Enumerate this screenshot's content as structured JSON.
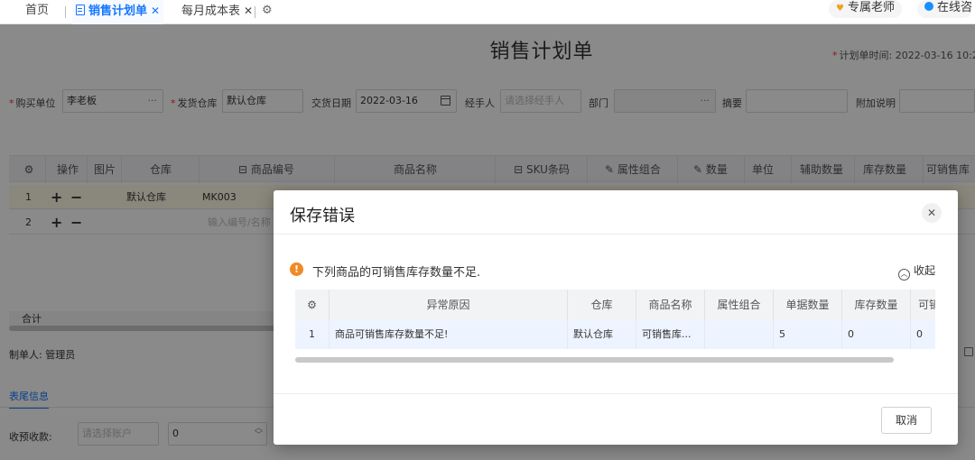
{
  "tabs": {
    "home": "首页",
    "sales_plan": "销售计划单",
    "monthly_cost": "每月成本表",
    "close_glyph": "✕"
  },
  "top_right": {
    "teacher": "专属老师",
    "online": "在线咨"
  },
  "page": {
    "title": "销售计划单",
    "plan_time_label": "计划单时间:",
    "plan_time_value": "2022-03-16 10:2"
  },
  "form": {
    "buyer_label": "购买单位",
    "buyer_value": "李老板",
    "warehouse_label": "发货仓库",
    "warehouse_value": "默认仓库",
    "delivery_date_label": "交货日期",
    "delivery_date_value": "2022-03-16",
    "handler_label": "经手人",
    "handler_placeholder": "请选择经手人",
    "dept_label": "部门",
    "summary_label": "摘要",
    "extra_label": "附加说明"
  },
  "grid": {
    "headers": [
      "操作",
      "图片",
      "仓库",
      "商品编号",
      "商品名称",
      "SKU条码",
      "属性组合",
      "数量",
      "单位",
      "辅助数量",
      "库存数量",
      "可销售库"
    ],
    "rows": [
      {
        "no": "1",
        "warehouse": "默认仓库",
        "code": "MK003"
      },
      {
        "no": "2",
        "code_placeholder": "输入编号/名称"
      }
    ],
    "plus": "+",
    "minus": "−",
    "total_label": "合计"
  },
  "footer": {
    "maker": "制单人: 管理员",
    "tail_tab": "表尾信息",
    "receive_label": "收预收款:",
    "account_placeholder": "请选择账户",
    "amount_value": "0"
  },
  "modal": {
    "title": "保存错误",
    "message": "下列商品的可销售库存数量不足.",
    "collapse_label": "收起",
    "table": {
      "headers": [
        "异常原因",
        "仓库",
        "商品名称",
        "属性组合",
        "单据数量",
        "库存数量",
        "可销"
      ],
      "row": {
        "no": "1",
        "reason": "商品可销售库存数量不足!",
        "warehouse": "默认仓库",
        "product": "可销售库...",
        "attr": "",
        "doc_qty": "5",
        "stock_qty": "0",
        "sellable": "0"
      }
    },
    "cancel_label": "取消"
  },
  "icons": {
    "gear": "gear-icon",
    "doc": "document-icon",
    "calendar": "calendar-icon",
    "warning": "warning-icon",
    "close": "close-icon",
    "collapse": "chevron-up-icon"
  },
  "colors": {
    "accent": "#1677ff",
    "warning": "#f08a24",
    "required": "#e33333"
  }
}
